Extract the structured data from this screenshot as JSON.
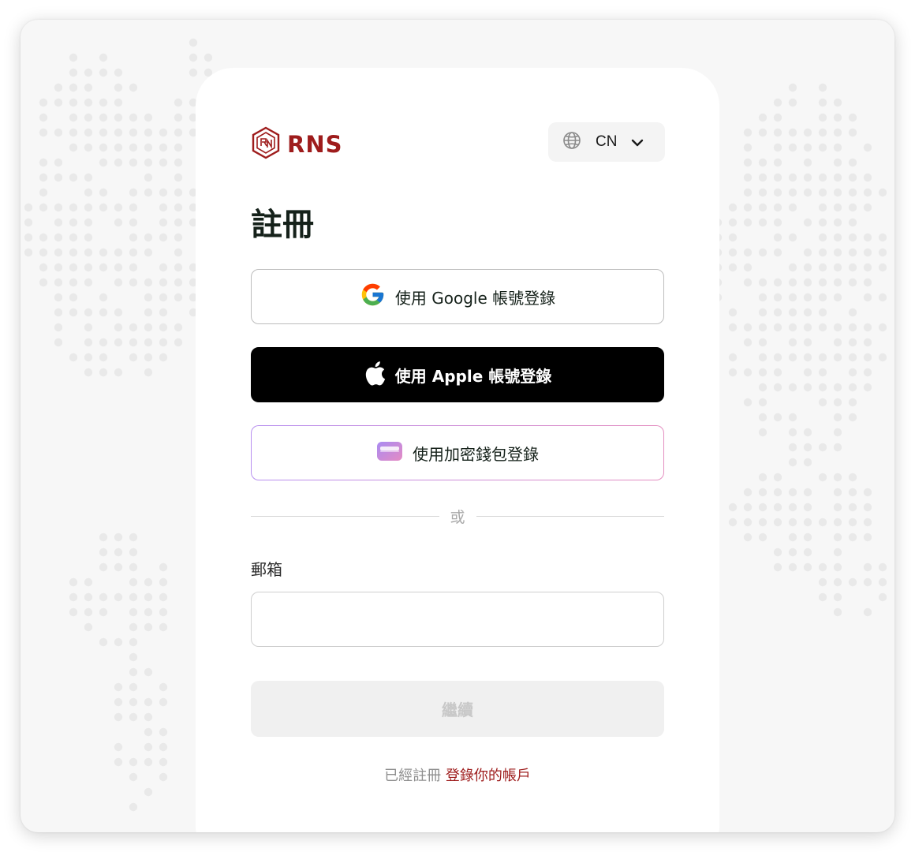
{
  "brand": {
    "name": "RNS",
    "color": "#9e1c1c",
    "logo_icon": "rns-hexagon-logo-icon"
  },
  "language": {
    "icon": "globe-icon",
    "code": "CN",
    "chevron_icon": "chevron-down-icon"
  },
  "page": {
    "title": "註冊"
  },
  "social": {
    "google_label": "使用 Google 帳號登錄",
    "google_icon": "google-icon",
    "apple_label": "使用 Apple 帳號登錄",
    "apple_icon": "apple-icon",
    "wallet_label": "使用加密錢包登錄",
    "wallet_icon": "wallet-icon"
  },
  "divider": {
    "text": "或"
  },
  "form": {
    "email_label": "郵箱",
    "email_value": "",
    "continue_label": "繼續"
  },
  "footer": {
    "prompt": "已經註冊",
    "login_link": "登錄你的帳戶"
  }
}
